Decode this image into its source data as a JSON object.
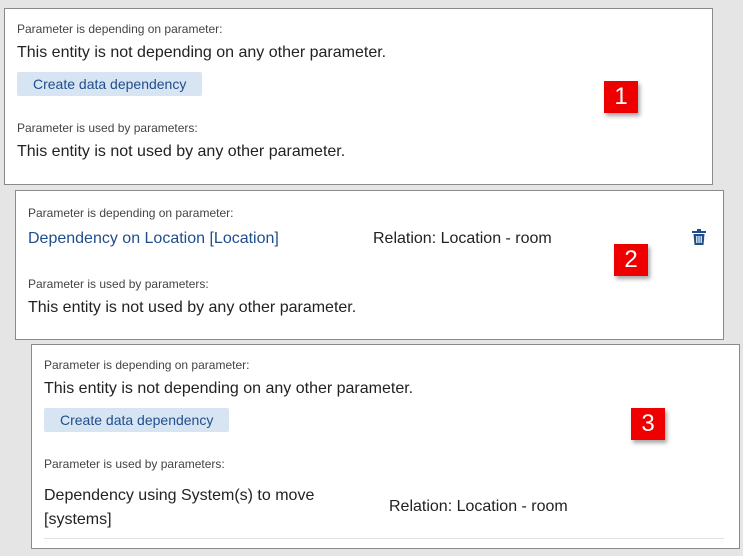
{
  "panels": [
    {
      "depending_label": "Parameter is depending on parameter:",
      "depending_text": "This entity is not depending on any other parameter.",
      "create_button": "Create data dependency",
      "used_by_label": "Parameter is used by parameters:",
      "used_by_text": "This entity is not used by any other parameter.",
      "badge": "1"
    },
    {
      "depending_label": "Parameter is depending on parameter:",
      "dependency_link": "Dependency on Location [Location]",
      "relation": "Relation: Location - room",
      "used_by_label": "Parameter is used by parameters:",
      "used_by_text": "This entity is not used by any other parameter.",
      "badge": "2"
    },
    {
      "depending_label": "Parameter is depending on parameter:",
      "depending_text": "This entity is not depending on any other parameter.",
      "create_button": "Create data dependency",
      "used_by_label": "Parameter is used by parameters:",
      "used_by_item": "Dependency using System(s) to move [systems]",
      "relation": "Relation: Location - room",
      "badge": "3"
    }
  ],
  "icons": {
    "delete": "trash-icon"
  },
  "colors": {
    "badge": "#ee0000",
    "link": "#1f4e8c",
    "button_bg": "#d7e4f2"
  }
}
